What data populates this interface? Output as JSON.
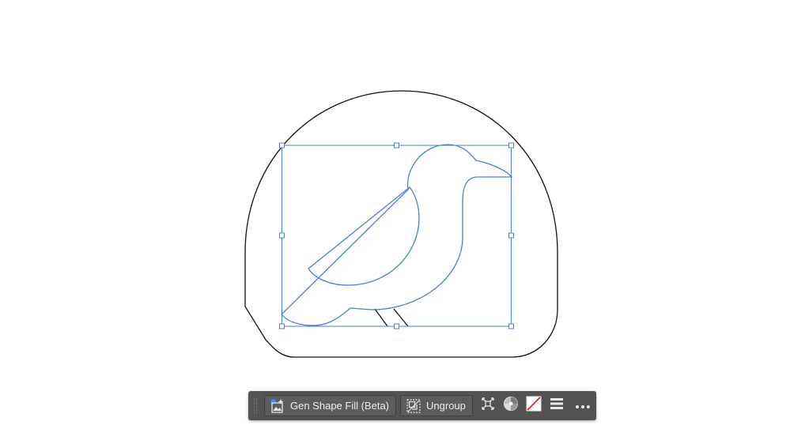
{
  "taskbar": {
    "gen_shape_fill_label": "Gen Shape Fill (Beta)",
    "ungroup_label": "Ungroup",
    "icons": {
      "gen_shape_fill": "gen-shape-fill-icon",
      "ungroup": "ungroup-icon",
      "isolate": "isolate-selection-icon",
      "recolor": "recolor-icon",
      "fill_stroke": "fill-none-swatch-icon",
      "align": "align-menu-icon",
      "more": "more-options-icon"
    }
  },
  "colors": {
    "selection": "#4a7fd6",
    "outline": "#111111",
    "taskbar_bg": "#535353",
    "none_swatch_slash": "#d2191f"
  }
}
